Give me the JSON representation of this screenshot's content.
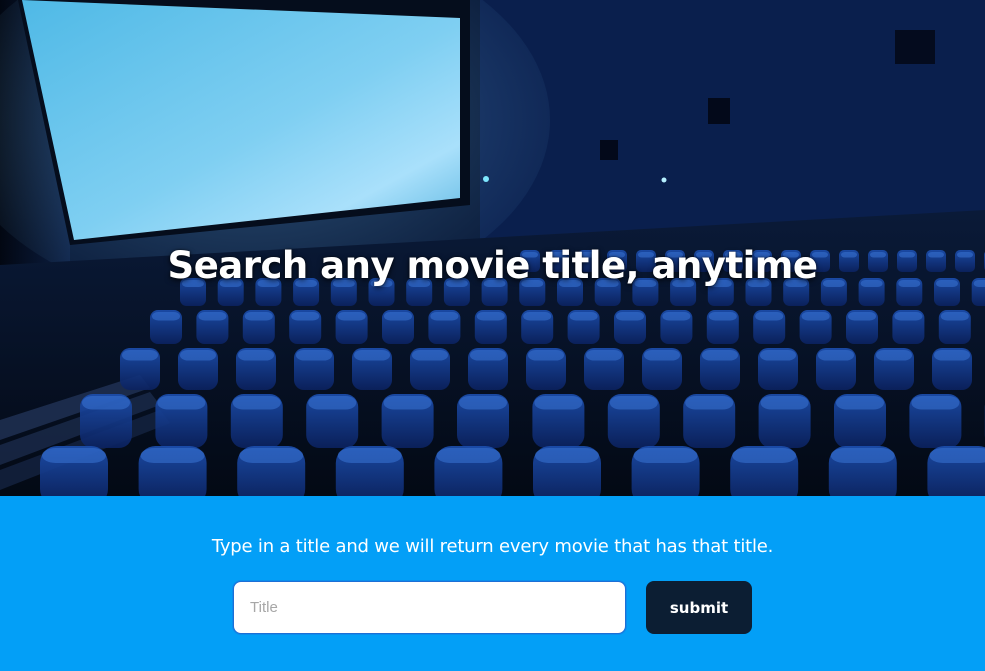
{
  "hero": {
    "title": "Search any movie title, anytime",
    "background_image": "cinema-theater-seats"
  },
  "search": {
    "tagline": "Type in a title and we will return every movie that has that title.",
    "input_placeholder": "Title",
    "input_value": "",
    "submit_label": "submit"
  },
  "colors": {
    "section_background": "#039ff7",
    "button_background": "#0c1e33",
    "button_text": "#ffffff",
    "heading_text": "#ffffff"
  }
}
